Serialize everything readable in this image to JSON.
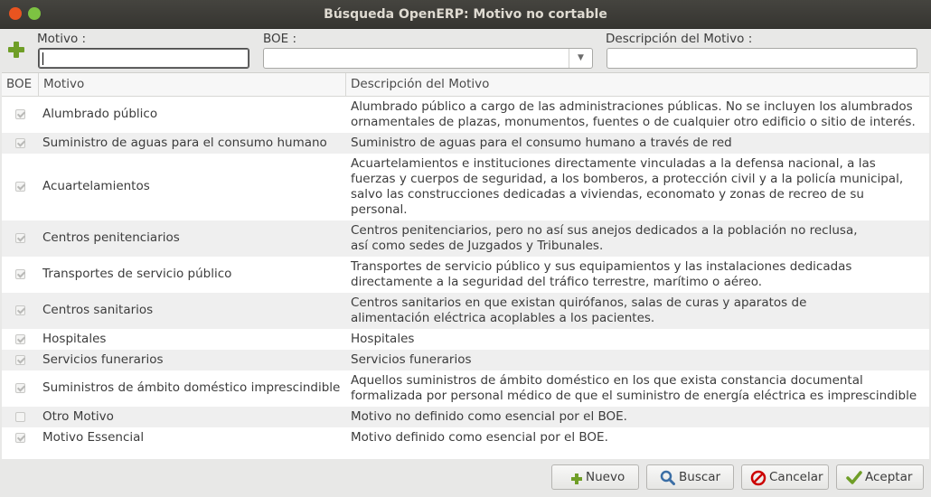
{
  "window": {
    "title": "Búsqueda OpenERP: Motivo no cortable"
  },
  "search": {
    "motivo_label": "Motivo :",
    "motivo_value": "",
    "boe_label": "BOE :",
    "boe_value": "",
    "descripcion_label": "Descripción del Motivo :",
    "descripcion_value": ""
  },
  "table": {
    "columns": [
      "BOE",
      "Motivo",
      "Descripción del Motivo"
    ],
    "rows": [
      {
        "boe": true,
        "motivo": "Alumbrado público",
        "descripcion": "Alumbrado público a cargo de las administraciones públicas. No se incluyen los alumbrados\nornamentales de plazas, monumentos, fuentes o de cualquier otro edificio o sitio de interés."
      },
      {
        "boe": true,
        "motivo": "Suministro de aguas para el consumo humano",
        "descripcion": "Suministro de aguas para el consumo humano a través de red"
      },
      {
        "boe": true,
        "motivo": "Acuartelamientos",
        "descripcion": "Acuartelamientos e instituciones directamente vinculadas a la defensa nacional, a las\nfuerzas y cuerpos de seguridad, a los bomberos, a protección civil y a la policía municipal,\nsalvo las construcciones dedicadas a viviendas, economato y zonas de recreo de su\npersonal."
      },
      {
        "boe": true,
        "motivo": "Centros penitenciarios",
        "descripcion": "Centros penitenciarios, pero no así sus anejos dedicados a la población no reclusa,\nasí como sedes de Juzgados y Tribunales."
      },
      {
        "boe": true,
        "motivo": "Transportes de servicio público",
        "descripcion": "Transportes de servicio público y sus equipamientos y las instalaciones dedicadas\ndirectamente a la seguridad del tráfico terrestre, marítimo o aéreo."
      },
      {
        "boe": true,
        "motivo": "Centros sanitarios",
        "descripcion": "Centros sanitarios en que existan quirófanos, salas de curas y aparatos de\nalimentación eléctrica acoplables a los pacientes."
      },
      {
        "boe": true,
        "motivo": "Hospitales",
        "descripcion": "Hospitales"
      },
      {
        "boe": true,
        "motivo": "Servicios funerarios",
        "descripcion": "Servicios funerarios"
      },
      {
        "boe": true,
        "motivo": "Suministros de ámbito doméstico imprescindible",
        "descripcion": "Aquellos suministros de ámbito doméstico en los que exista constancia documental\nformalizada por personal médico de que el suministro de energía eléctrica es imprescindible"
      },
      {
        "boe": false,
        "motivo": "Otro Motivo",
        "descripcion": "Motivo no definido como esencial por el BOE."
      },
      {
        "boe": true,
        "motivo": "Motivo Essencial",
        "descripcion": "Motivo  definido como esencial por el BOE."
      }
    ]
  },
  "buttons": {
    "nuevo": "Nuevo",
    "buscar": "Buscar",
    "cancelar": "Cancelar",
    "aceptar": "Aceptar"
  },
  "colors": {
    "accent_green": "#6f9e27",
    "cancel_red": "#cc0000",
    "search_blue": "#3b6ea5",
    "titlebar": "#3c3b37"
  },
  "icons": [
    "close-icon",
    "maximize-icon",
    "add-icon",
    "dropdown-arrow-icon",
    "checkbox-icon",
    "plus-icon",
    "search-icon",
    "cancel-icon",
    "checkmark-icon"
  ]
}
